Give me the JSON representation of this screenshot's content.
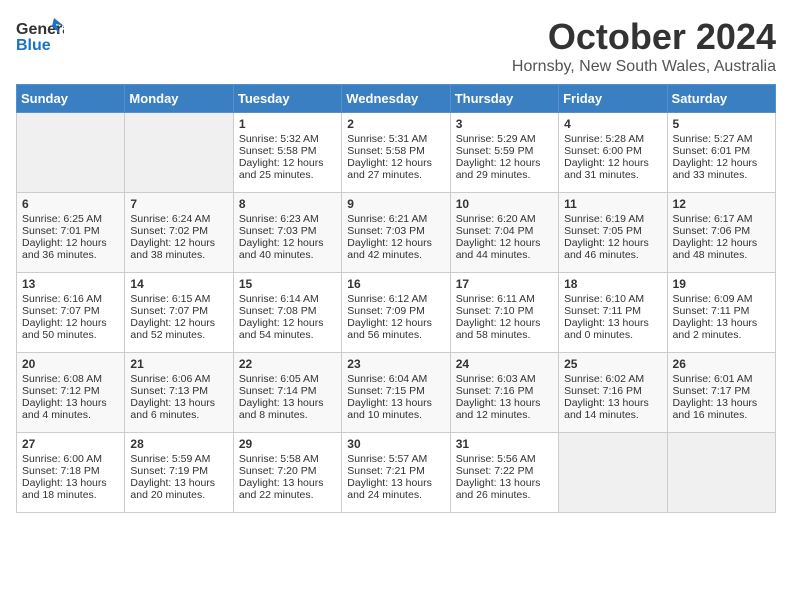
{
  "logo": {
    "line1": "General",
    "line2": "Blue"
  },
  "title": "October 2024",
  "location": "Hornsby, New South Wales, Australia",
  "days_of_week": [
    "Sunday",
    "Monday",
    "Tuesday",
    "Wednesday",
    "Thursday",
    "Friday",
    "Saturday"
  ],
  "weeks": [
    [
      {
        "day": "",
        "content": ""
      },
      {
        "day": "",
        "content": ""
      },
      {
        "day": "1",
        "content": "Sunrise: 5:32 AM\nSunset: 5:58 PM\nDaylight: 12 hours\nand 25 minutes."
      },
      {
        "day": "2",
        "content": "Sunrise: 5:31 AM\nSunset: 5:58 PM\nDaylight: 12 hours\nand 27 minutes."
      },
      {
        "day": "3",
        "content": "Sunrise: 5:29 AM\nSunset: 5:59 PM\nDaylight: 12 hours\nand 29 minutes."
      },
      {
        "day": "4",
        "content": "Sunrise: 5:28 AM\nSunset: 6:00 PM\nDaylight: 12 hours\nand 31 minutes."
      },
      {
        "day": "5",
        "content": "Sunrise: 5:27 AM\nSunset: 6:01 PM\nDaylight: 12 hours\nand 33 minutes."
      }
    ],
    [
      {
        "day": "6",
        "content": "Sunrise: 6:25 AM\nSunset: 7:01 PM\nDaylight: 12 hours\nand 36 minutes."
      },
      {
        "day": "7",
        "content": "Sunrise: 6:24 AM\nSunset: 7:02 PM\nDaylight: 12 hours\nand 38 minutes."
      },
      {
        "day": "8",
        "content": "Sunrise: 6:23 AM\nSunset: 7:03 PM\nDaylight: 12 hours\nand 40 minutes."
      },
      {
        "day": "9",
        "content": "Sunrise: 6:21 AM\nSunset: 7:03 PM\nDaylight: 12 hours\nand 42 minutes."
      },
      {
        "day": "10",
        "content": "Sunrise: 6:20 AM\nSunset: 7:04 PM\nDaylight: 12 hours\nand 44 minutes."
      },
      {
        "day": "11",
        "content": "Sunrise: 6:19 AM\nSunset: 7:05 PM\nDaylight: 12 hours\nand 46 minutes."
      },
      {
        "day": "12",
        "content": "Sunrise: 6:17 AM\nSunset: 7:06 PM\nDaylight: 12 hours\nand 48 minutes."
      }
    ],
    [
      {
        "day": "13",
        "content": "Sunrise: 6:16 AM\nSunset: 7:07 PM\nDaylight: 12 hours\nand 50 minutes."
      },
      {
        "day": "14",
        "content": "Sunrise: 6:15 AM\nSunset: 7:07 PM\nDaylight: 12 hours\nand 52 minutes."
      },
      {
        "day": "15",
        "content": "Sunrise: 6:14 AM\nSunset: 7:08 PM\nDaylight: 12 hours\nand 54 minutes."
      },
      {
        "day": "16",
        "content": "Sunrise: 6:12 AM\nSunset: 7:09 PM\nDaylight: 12 hours\nand 56 minutes."
      },
      {
        "day": "17",
        "content": "Sunrise: 6:11 AM\nSunset: 7:10 PM\nDaylight: 12 hours\nand 58 minutes."
      },
      {
        "day": "18",
        "content": "Sunrise: 6:10 AM\nSunset: 7:11 PM\nDaylight: 13 hours\nand 0 minutes."
      },
      {
        "day": "19",
        "content": "Sunrise: 6:09 AM\nSunset: 7:11 PM\nDaylight: 13 hours\nand 2 minutes."
      }
    ],
    [
      {
        "day": "20",
        "content": "Sunrise: 6:08 AM\nSunset: 7:12 PM\nDaylight: 13 hours\nand 4 minutes."
      },
      {
        "day": "21",
        "content": "Sunrise: 6:06 AM\nSunset: 7:13 PM\nDaylight: 13 hours\nand 6 minutes."
      },
      {
        "day": "22",
        "content": "Sunrise: 6:05 AM\nSunset: 7:14 PM\nDaylight: 13 hours\nand 8 minutes."
      },
      {
        "day": "23",
        "content": "Sunrise: 6:04 AM\nSunset: 7:15 PM\nDaylight: 13 hours\nand 10 minutes."
      },
      {
        "day": "24",
        "content": "Sunrise: 6:03 AM\nSunset: 7:16 PM\nDaylight: 13 hours\nand 12 minutes."
      },
      {
        "day": "25",
        "content": "Sunrise: 6:02 AM\nSunset: 7:16 PM\nDaylight: 13 hours\nand 14 minutes."
      },
      {
        "day": "26",
        "content": "Sunrise: 6:01 AM\nSunset: 7:17 PM\nDaylight: 13 hours\nand 16 minutes."
      }
    ],
    [
      {
        "day": "27",
        "content": "Sunrise: 6:00 AM\nSunset: 7:18 PM\nDaylight: 13 hours\nand 18 minutes."
      },
      {
        "day": "28",
        "content": "Sunrise: 5:59 AM\nSunset: 7:19 PM\nDaylight: 13 hours\nand 20 minutes."
      },
      {
        "day": "29",
        "content": "Sunrise: 5:58 AM\nSunset: 7:20 PM\nDaylight: 13 hours\nand 22 minutes."
      },
      {
        "day": "30",
        "content": "Sunrise: 5:57 AM\nSunset: 7:21 PM\nDaylight: 13 hours\nand 24 minutes."
      },
      {
        "day": "31",
        "content": "Sunrise: 5:56 AM\nSunset: 7:22 PM\nDaylight: 13 hours\nand 26 minutes."
      },
      {
        "day": "",
        "content": ""
      },
      {
        "day": "",
        "content": ""
      }
    ]
  ]
}
